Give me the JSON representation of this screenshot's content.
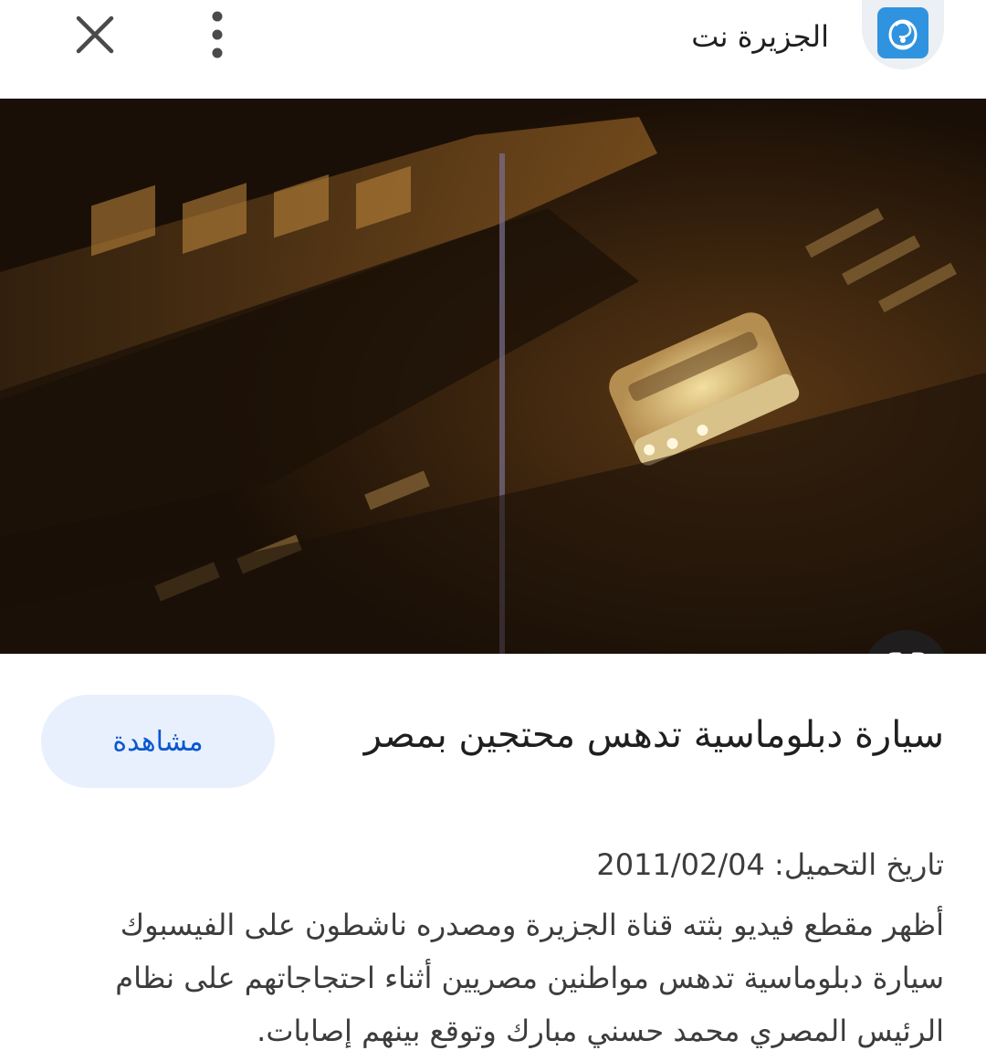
{
  "header": {
    "source_name": "الجزيرة نت",
    "icons": {
      "close": "close-icon",
      "more": "more-vert-icon",
      "logo": "al-jazeera-logo"
    }
  },
  "image": {
    "description_icon": "google-lens-icon"
  },
  "content": {
    "title": "سيارة دبلوماسية تدهس محتجين بمصر",
    "watch_button_label": "مشاهدة",
    "upload_label": "تاريخ التحميل:",
    "upload_date": "2011/02/04",
    "description": "أظهر مقطع فيديو بثته قناة الجزيرة ومصدره ناشطون على الفيسبوك سيارة دبلوماسية تدهس مواطنين مصريين أثناء احتجاجاتهم على نظام الرئيس المصري محمد حسني مبارك وتوقع بينهم إصابات."
  },
  "colors": {
    "accent": "#0b57d0",
    "button_bg": "#e8f0fe",
    "logo_bg": "#2f93df",
    "text": "#1f1f1f"
  }
}
